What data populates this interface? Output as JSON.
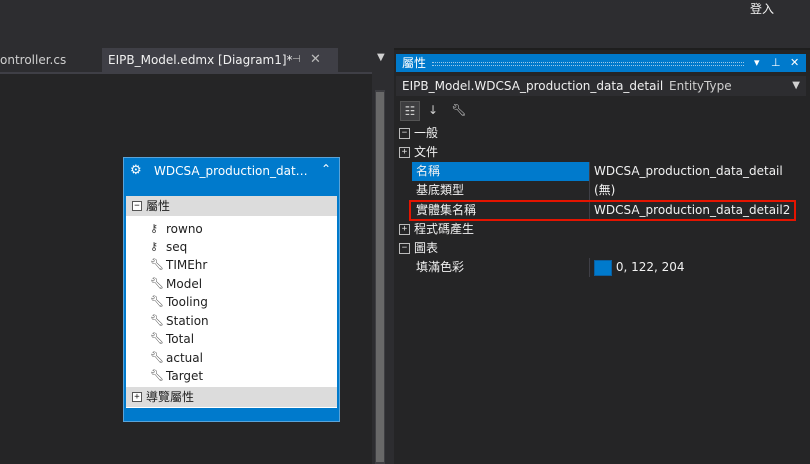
{
  "topbar": {
    "login_label": "登入"
  },
  "tabs": [
    {
      "label": "ontroller.cs"
    },
    {
      "label": "EIPB_Model.edmx [Diagram1]*",
      "pin_icon": "pin-icon",
      "close_icon": "close-icon"
    }
  ],
  "entity": {
    "name": "WDCSA_production_data_d...",
    "sections": {
      "properties": "屬性",
      "navigation": "導覽屬性"
    },
    "properties": [
      {
        "name": "rowno",
        "icon": "key-icon"
      },
      {
        "name": "seq",
        "icon": "key-icon"
      },
      {
        "name": "TIMEhr",
        "icon": "wrench-icon"
      },
      {
        "name": "Model",
        "icon": "wrench-icon"
      },
      {
        "name": "Tooling",
        "icon": "wrench-icon"
      },
      {
        "name": "Station",
        "icon": "wrench-icon"
      },
      {
        "name": "Total",
        "icon": "wrench-icon"
      },
      {
        "name": "actual",
        "icon": "wrench-icon"
      },
      {
        "name": "Target",
        "icon": "wrench-icon"
      }
    ]
  },
  "properties_panel": {
    "title": "屬性",
    "object_name": "EIPB_Model.WDCSA_production_data_detail",
    "object_type": "EntityType",
    "categories": {
      "general": "一般",
      "documentation": "文件",
      "codegen": "程式碼產生",
      "diagram": "圖表"
    },
    "rows": {
      "name_key": "名稱",
      "name_value": "WDCSA_production_data_detail",
      "base_type_key": "基底類型",
      "base_type_value": "(無)",
      "entity_set_key": "實體集名稱",
      "entity_set_value": "WDCSA_production_data_detail2",
      "fill_color_key": "填滿色彩",
      "fill_color_value": "0, 122, 204"
    }
  },
  "colors": {
    "accent": "#007acc",
    "highlight_border": "#e51400",
    "background": "#1e1e1e"
  }
}
